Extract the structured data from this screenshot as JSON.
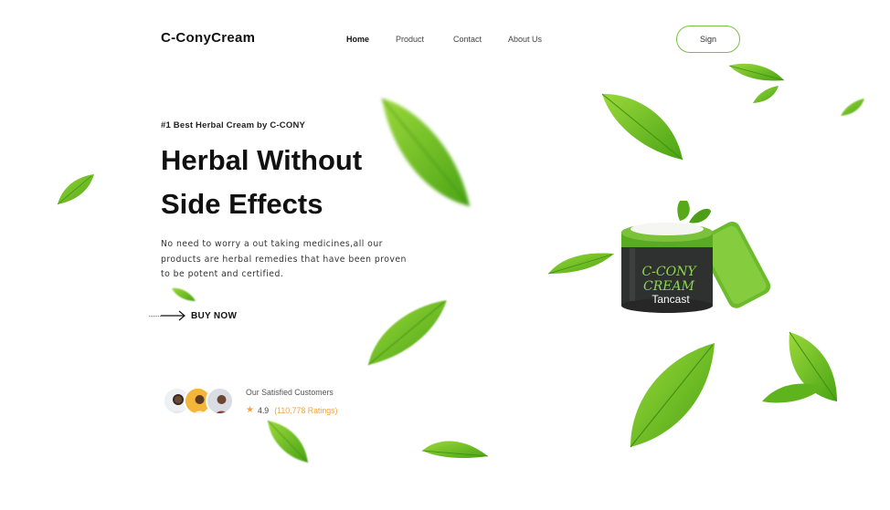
{
  "brand": {
    "logo_text": "C-ConyCream"
  },
  "nav": {
    "items": [
      {
        "label": "Home",
        "active": true
      },
      {
        "label": "Product",
        "active": false
      },
      {
        "label": "Contact",
        "active": false
      },
      {
        "label": "About Us",
        "active": false
      }
    ],
    "sign_label": "Sign"
  },
  "hero": {
    "eyebrow": "#1 Best Herbal Cream by C-CONY",
    "headline_line1": "Herbal Without",
    "headline_line2": "Side Effects",
    "description": "No need to worry a out taking medicines,all our products are herbal remedies that have been proven to be potent and certified.",
    "cta_label": "BUY NOW"
  },
  "customers": {
    "title": "Our Satisfied Customers",
    "rating": "4.9",
    "ratings_count": "(110,778 Ratings)",
    "avatar_count": 3
  },
  "product": {
    "jar_label_line1": "C-CONY",
    "jar_label_line2": "CREAM",
    "jar_brand": "Tancast"
  },
  "colors": {
    "accent_green": "#7cc043",
    "leaf_green": "#6fbf1f",
    "leaf_dark": "#3f8f12",
    "star_orange": "#f2a33a",
    "jar_body": "#2f3130"
  },
  "icons": {
    "cta_arrow": "arrow-right-icon",
    "star": "star-icon",
    "leaf": "leaf-icon"
  }
}
